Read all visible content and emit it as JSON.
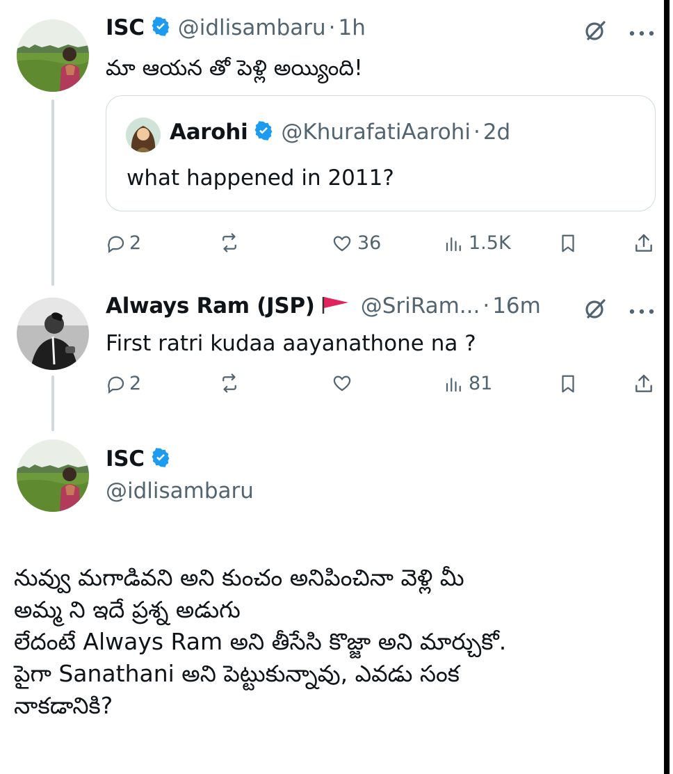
{
  "tweet1": {
    "name": "ISC",
    "handle": "@idlisambaru",
    "time": "1h",
    "text": "మా ఆయన తో పెళ్లి అయ్యింది!",
    "stats": {
      "replies": "2",
      "likes": "36",
      "views": "1.5K"
    }
  },
  "quoted": {
    "name": "Aarohi",
    "handle": "@KhurafatiAarohi",
    "time": "2d",
    "text": "what happened in 2011?"
  },
  "tweet2": {
    "name": "Always Ram (JSP)",
    "flag": "🚩",
    "handle": "@SriRam...",
    "time": "16m",
    "text": "First ratri kudaa aayanathone na ?",
    "stats": {
      "replies": "2",
      "views": "81"
    }
  },
  "tweet3": {
    "name": "ISC",
    "handle": "@idlisambaru",
    "lines": [
      "నువ్వు మగాడివని అని కుంచం అనిపించినా వెళ్లి మీ",
      "అమ్మ ని ఇదే ప్రశ్న అడుగు",
      "లేదంటే Always Ram అని తీసేసి కొజ్జా అని మార్చుకో.",
      "పైగా Sanathani అని పెట్టుకున్నావు, ఎవడు సంక",
      "నాకడానికి?"
    ]
  },
  "sep": "·",
  "colors": {
    "verified": "#1d9bf0",
    "secondary": "#536471",
    "flag": "#e0245e"
  }
}
